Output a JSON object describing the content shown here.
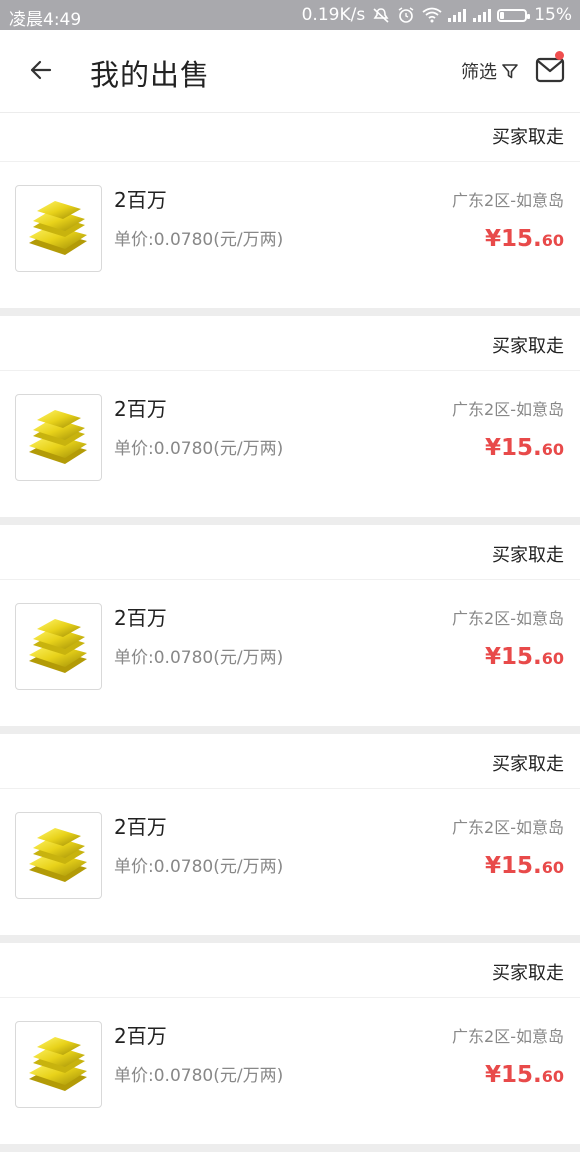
{
  "status_bar": {
    "time": "凌晨4:49",
    "network_speed": "0.19K/s",
    "battery": "15%",
    "battery_level": 0.15
  },
  "header": {
    "title": "我的出售",
    "filter_label": "筛选"
  },
  "colors": {
    "price": "#e84a4a",
    "badge": "#f04f4f",
    "statusbar": "#a9a9ad"
  },
  "orders": [
    {
      "status": "买家取走",
      "name": "2百万",
      "unit_price": "单价:0.0780(元/万两)",
      "server": "广东2区-如意岛",
      "price_int": "¥15.",
      "price_dec": "60"
    },
    {
      "status": "买家取走",
      "name": "2百万",
      "unit_price": "单价:0.0780(元/万两)",
      "server": "广东2区-如意岛",
      "price_int": "¥15.",
      "price_dec": "60"
    },
    {
      "status": "买家取走",
      "name": "2百万",
      "unit_price": "单价:0.0780(元/万两)",
      "server": "广东2区-如意岛",
      "price_int": "¥15.",
      "price_dec": "60"
    },
    {
      "status": "买家取走",
      "name": "2百万",
      "unit_price": "单价:0.0780(元/万两)",
      "server": "广东2区-如意岛",
      "price_int": "¥15.",
      "price_dec": "60"
    },
    {
      "status": "买家取走",
      "name": "2百万",
      "unit_price": "单价:0.0780(元/万两)",
      "server": "广东2区-如意岛",
      "price_int": "¥15.",
      "price_dec": "60"
    }
  ]
}
